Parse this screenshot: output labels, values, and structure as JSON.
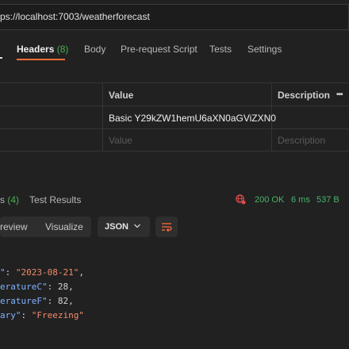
{
  "request": {
    "url": "ps://localhost:7003/weatherforecast",
    "tabs": [
      {
        "label": "Headers",
        "count": "(8)"
      },
      {
        "label": "Body"
      },
      {
        "label": "Pre-request Script"
      },
      {
        "label": "Tests"
      },
      {
        "label": "Settings"
      }
    ]
  },
  "headers_table": {
    "columns": [
      "Value",
      "Description",
      "•••"
    ],
    "rows": [
      {
        "value": "Basic Y29kZW1hemU6aXN0aGViZXN0"
      }
    ],
    "placeholders": {
      "value": "Value",
      "description": "Description"
    }
  },
  "response": {
    "tabs": [
      {
        "label": "s",
        "count": "(4)"
      },
      {
        "label": "Test Results"
      }
    ],
    "status": {
      "code": "200 OK",
      "time": "6 ms",
      "size": "537 B"
    },
    "view_modes": [
      "review",
      "Visualize"
    ],
    "format": "JSON",
    "body_lines": [
      {
        "key": "\"",
        "sep": ": ",
        "value": "\"2023-08-21\"",
        "tail": ",",
        "vtype": "str"
      },
      {
        "key": "eratureC\"",
        "sep": ": ",
        "value": "28",
        "tail": ",",
        "vtype": "num"
      },
      {
        "key": "eratureF\"",
        "sep": ": ",
        "value": "82",
        "tail": ",",
        "vtype": "num"
      },
      {
        "key": "ary\"",
        "sep": ": ",
        "value": "\"Freezing\"",
        "tail": "",
        "vtype": "str"
      }
    ]
  },
  "colors": {
    "accent": "#ff6c37",
    "success": "#49b36b",
    "count": "#4caf50",
    "json_key": "#7fb2ff",
    "json_string": "#f28b6a"
  },
  "icons": {
    "network": "globe-icon",
    "format_dropdown": "chevron-down-icon",
    "wrap": "wrap-lines-icon"
  }
}
